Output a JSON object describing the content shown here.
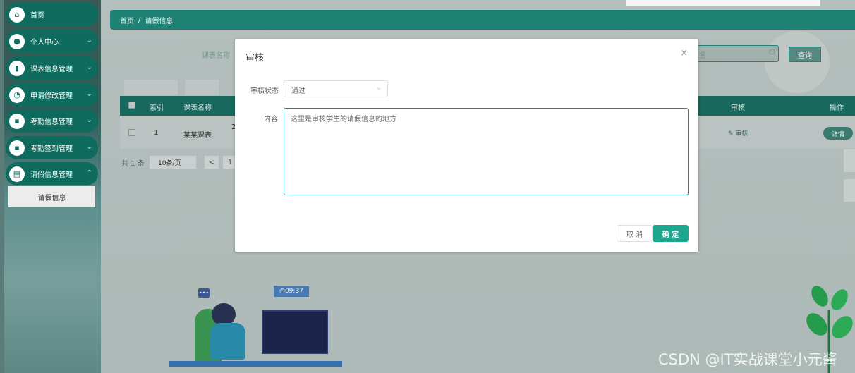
{
  "sidebar": {
    "items": [
      {
        "label": "首页",
        "icon": "home-icon"
      },
      {
        "label": "个人中心",
        "icon": "user-icon"
      },
      {
        "label": "课表信息管理",
        "icon": "bar-chart-icon"
      },
      {
        "label": "申请修改管理",
        "icon": "pie-icon"
      },
      {
        "label": "考勤信息管理",
        "icon": "message-icon"
      },
      {
        "label": "考勤签到管理",
        "icon": "message-icon"
      },
      {
        "label": "请假信息管理",
        "icon": "clipboard-icon"
      }
    ],
    "submenu_label": "请假信息"
  },
  "breadcrumb": {
    "home": "首页",
    "separator": "/",
    "current": "请假信息"
  },
  "search": {
    "label": "课表名称",
    "placeholder": "名",
    "button": "查询"
  },
  "table": {
    "headers": [
      "索引",
      "课表名称",
      "审核",
      "操作"
    ],
    "row": {
      "index": "1",
      "course": "某某课表",
      "partial": "2",
      "review_link": "审核",
      "detail_button": "详情"
    }
  },
  "pager": {
    "total": "共 1 条",
    "page_size": "10条/页",
    "prev": "<",
    "page": "1"
  },
  "illustration": {
    "clock": "09:37"
  },
  "dialog": {
    "title": "审核",
    "close": "×",
    "status_label": "审核状态",
    "status_value": "通过",
    "content_label": "内容",
    "content_value": "这里是审核学生的请假信息的地方",
    "cancel": "取 消",
    "confirm": "确 定"
  },
  "watermark": "CSDN @IT实战课堂小元酱",
  "colors": {
    "primary": "#20897a",
    "confirm": "#20a58f",
    "menu": "#0f6b5e"
  }
}
